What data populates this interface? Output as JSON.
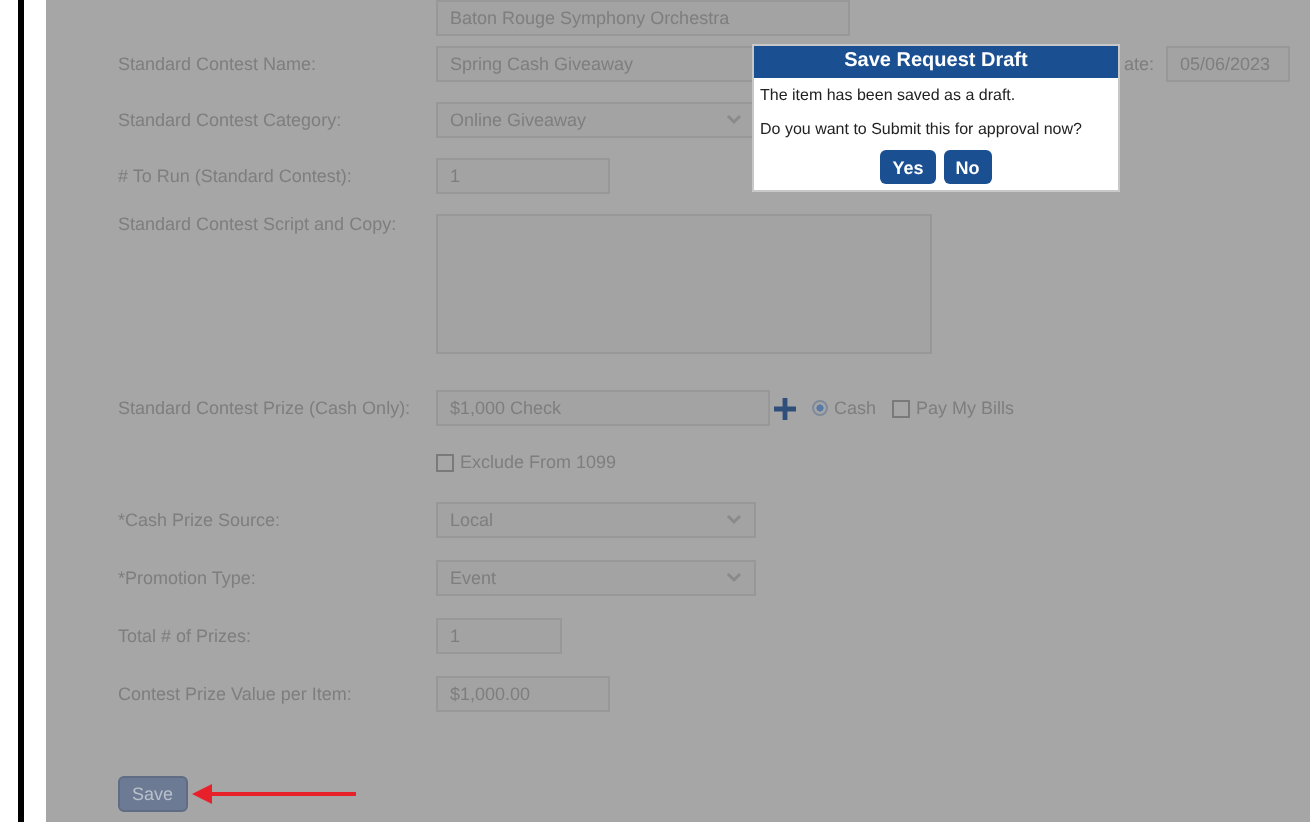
{
  "top_field": {
    "value": "Baton Rouge Symphony Orchestra"
  },
  "fields": [
    {
      "kind": "text",
      "label": "Standard Contest Name:",
      "value": "Spring Cash Giveaway",
      "side_label": "ate:",
      "side_value": "05/06/2023"
    },
    {
      "kind": "select",
      "label": "Standard Contest Category:",
      "value": "Online Giveaway"
    },
    {
      "kind": "short",
      "label": "# To Run (Standard Contest):",
      "value": "1"
    },
    {
      "kind": "textarea",
      "label": "Standard Contest Script and Copy:"
    },
    {
      "kind": "prize",
      "label": "Standard Contest Prize (Cash Only):",
      "value": "$1,000 Check",
      "options": [
        {
          "label": "Cash",
          "selected": true
        },
        {
          "label": "Pay My Bills",
          "selected": false
        }
      ]
    },
    {
      "kind": "checkbox",
      "label": "Exclude From 1099",
      "checked": false
    },
    {
      "kind": "select",
      "label": "*Cash Prize Source:",
      "value": "Local"
    },
    {
      "kind": "select",
      "label": "*Promotion Type:",
      "value": "Event"
    },
    {
      "kind": "short",
      "label": "Total # of Prizes:",
      "value": "1"
    },
    {
      "kind": "medium",
      "label": "Contest Prize Value per Item:",
      "value": "$1,000.00"
    }
  ],
  "save_button": "Save",
  "dialog": {
    "title": "Save Request Draft",
    "message": "The item has been saved as a draft.",
    "question": "Do you want to Submit this for approval now?",
    "buttons": [
      "Yes",
      "No"
    ]
  }
}
